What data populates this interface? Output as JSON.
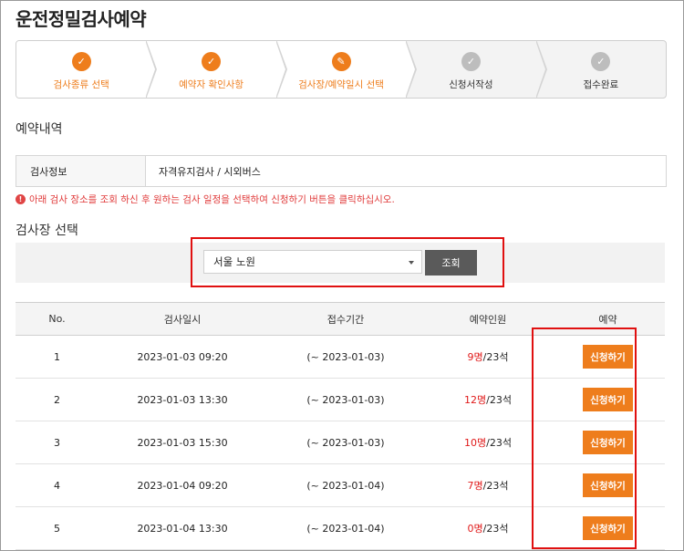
{
  "page_title": "운전정밀검사예약",
  "steps": [
    {
      "label": "검사종류 선택",
      "state": "done",
      "icon": "check-icon"
    },
    {
      "label": "예약자 확인사항",
      "state": "done",
      "icon": "check-icon"
    },
    {
      "label": "검사장/예약일시 선택",
      "state": "current",
      "icon": "pencil-icon"
    },
    {
      "label": "신청서작성",
      "state": "pending",
      "icon": "check-icon"
    },
    {
      "label": "접수완료",
      "state": "pending",
      "icon": "check-icon"
    }
  ],
  "reservation": {
    "section_title": "예약내역",
    "info_label": "검사정보",
    "info_value": "자격유지검사 / 시외버스"
  },
  "notice": "아래 검사 장소를 조회 하신 후 원하는 검사 일정을 선택하여 신청하기 버튼을 클릭하십시오.",
  "center_section": {
    "title": "검사장 선택",
    "selected": "서울 노원",
    "search_label": "조회"
  },
  "table": {
    "headers": [
      "No.",
      "검사일시",
      "접수기간",
      "예약인원",
      "예약"
    ],
    "rows": [
      {
        "no": "1",
        "datetime": "2023-01-03 09:20",
        "period": "(~ 2023-01-03)",
        "booked": "9명",
        "capacity": "/23석",
        "action": "신청하기"
      },
      {
        "no": "2",
        "datetime": "2023-01-03 13:30",
        "period": "(~ 2023-01-03)",
        "booked": "12명",
        "capacity": "/23석",
        "action": "신청하기"
      },
      {
        "no": "3",
        "datetime": "2023-01-03 15:30",
        "period": "(~ 2023-01-03)",
        "booked": "10명",
        "capacity": "/23석",
        "action": "신청하기"
      },
      {
        "no": "4",
        "datetime": "2023-01-04 09:20",
        "period": "(~ 2023-01-04)",
        "booked": "7명",
        "capacity": "/23석",
        "action": "신청하기"
      },
      {
        "no": "5",
        "datetime": "2023-01-04 13:30",
        "period": "(~ 2023-01-04)",
        "booked": "0명",
        "capacity": "/23석",
        "action": "신청하기"
      }
    ]
  },
  "colors": {
    "accent": "#ee7d1c",
    "highlight_border": "#e01010",
    "count_text": "#e01a1a"
  }
}
